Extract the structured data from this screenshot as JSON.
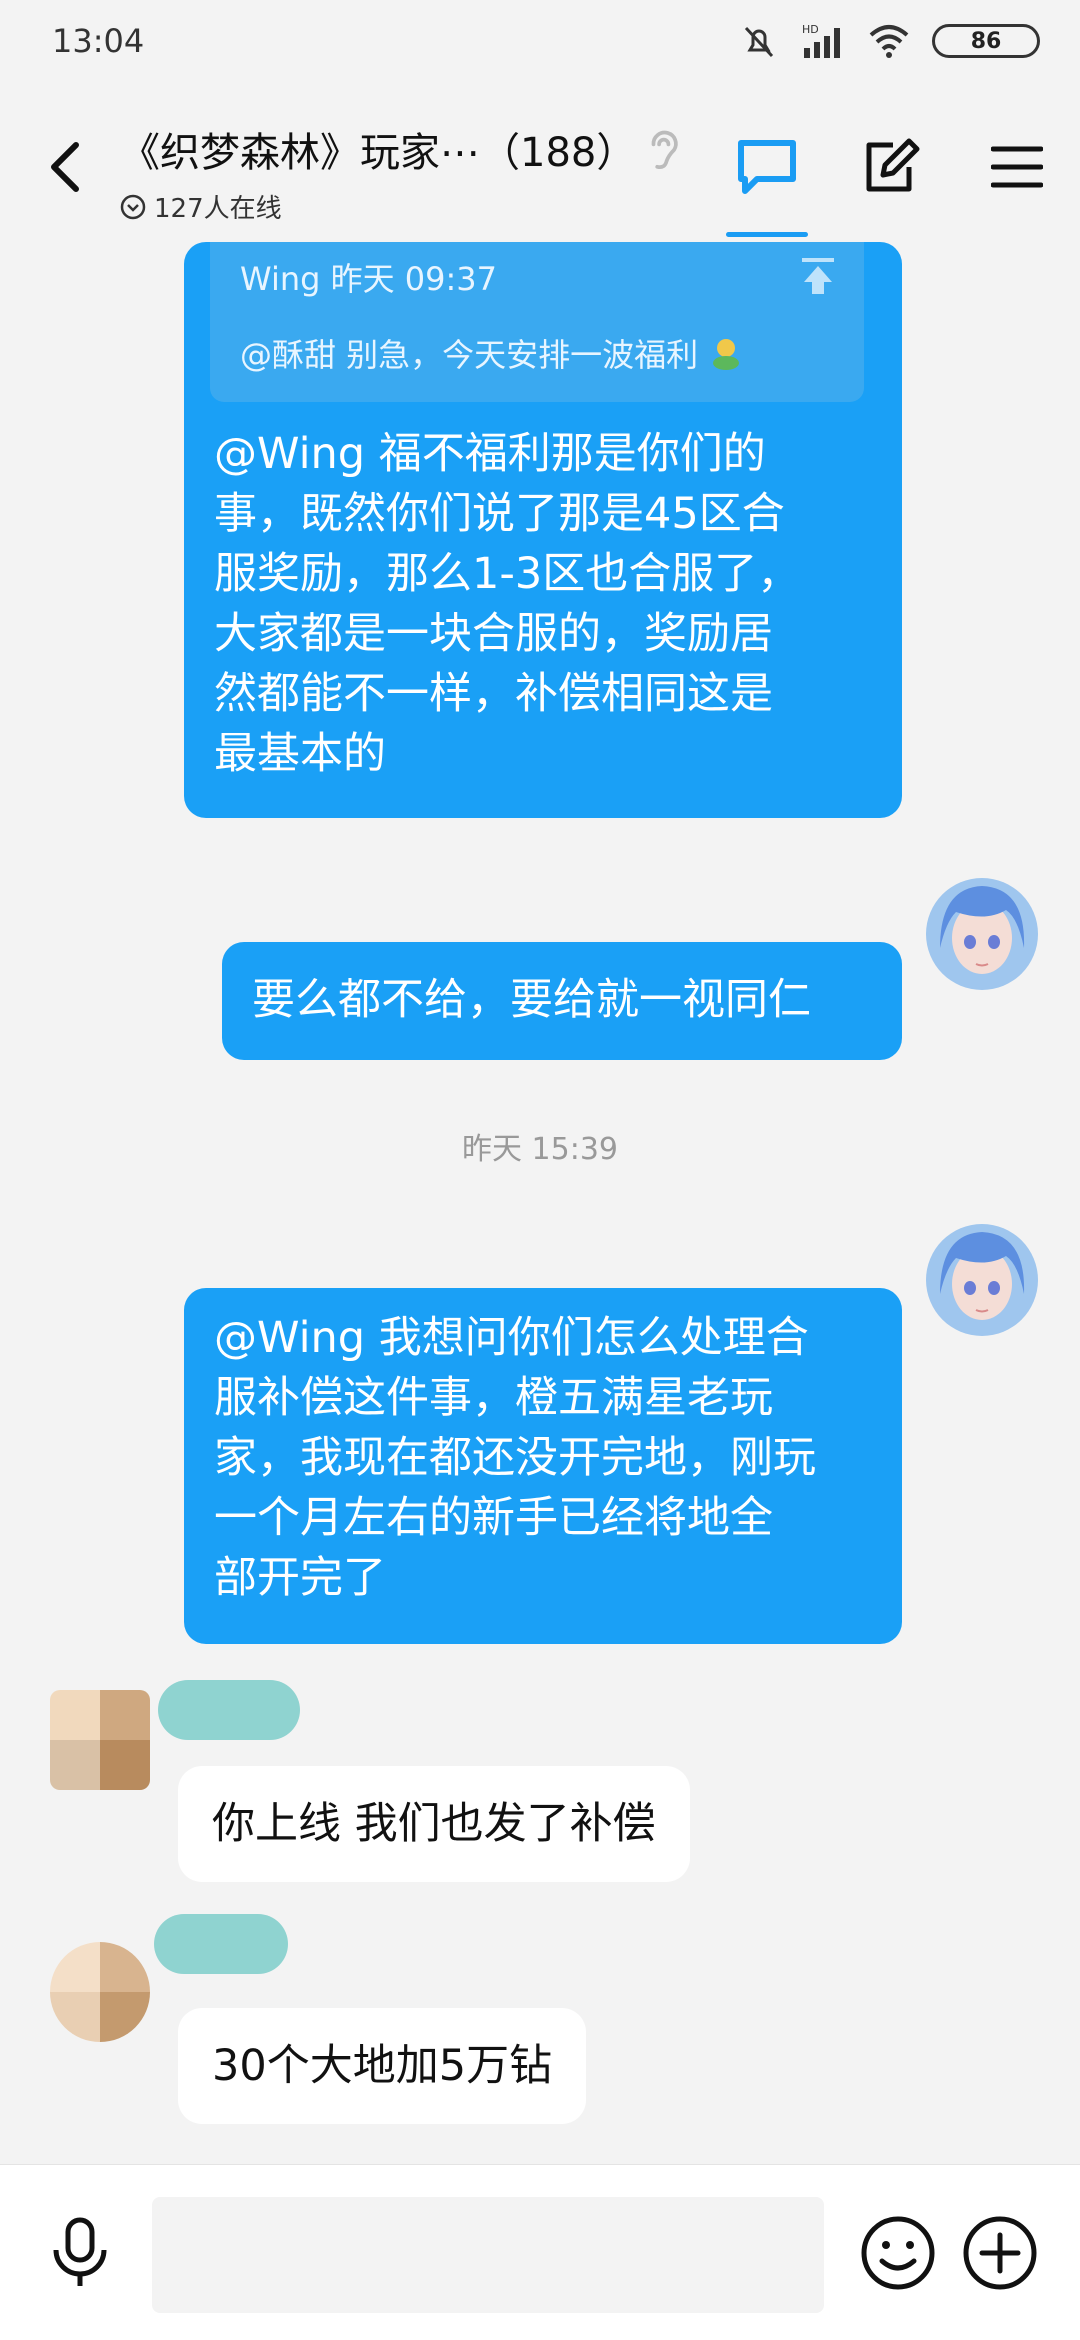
{
  "status": {
    "time": "13:04",
    "battery": "86",
    "hd": "HD"
  },
  "header": {
    "title": "《织梦森林》玩家⋯（188）",
    "online": "127人在线"
  },
  "messages": {
    "quote_head": "Wing  昨天 09:37",
    "quote_text": "@酥甜 别急，今天安排一波福利",
    "msg1": [
      "@Wing 福不福利那是你们的",
      "事，既然你们说了那是45区合",
      "服奖励，那么1-3区也合服了，",
      "大家都是一块合服的，奖励居",
      "然都能不一样，补偿相同这是",
      "最基本的"
    ],
    "msg2": "要么都不给，要给就一视同仁",
    "time_sep": "昨天 15:39",
    "msg3": [
      "@Wing 我想问你们怎么处理合",
      "服补偿这件事，橙五满星老玩",
      "家，我现在都还没开完地，刚玩",
      "一个月左右的新手已经将地全",
      "部开完了"
    ],
    "msg4": "你上线 我们也发了补偿",
    "msg5": "30个大地加5万钻"
  },
  "input": {
    "placeholder": ""
  },
  "colors": {
    "accent": "#1aa0f6",
    "background": "#f3f3f3"
  },
  "icons": [
    "back-icon",
    "ear-icon",
    "chat-icon",
    "edit-icon",
    "menu-icon",
    "mic-icon",
    "emoji-icon",
    "plus-icon",
    "pin-top-icon",
    "mute-icon",
    "signal-icon",
    "wifi-icon"
  ]
}
